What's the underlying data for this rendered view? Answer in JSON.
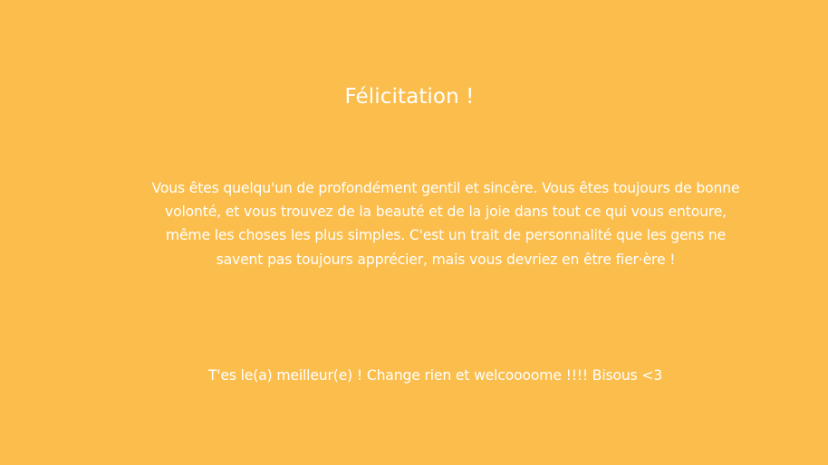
{
  "page": {
    "title": "Félicitation !",
    "message_lines": [
      "Vous êtes quelqu'un de profondément gentil et sincère. Vous êtes toujours de bonne",
      "volonté, et vous trouvez de la beauté et de la joie dans tout ce qui vous entoure,",
      "même les choses les plus simples. C'est un trait de personnalité que les gens ne",
      "savent pas toujours apprécier, mais vous devriez en être fier·ère !"
    ],
    "footer": "T'es le(a) meilleur(e) ! Change rien et welcoooome !!!! Bisous <3"
  },
  "colors": {
    "background": "#FBBE4D",
    "text": "#FFFFFF"
  }
}
